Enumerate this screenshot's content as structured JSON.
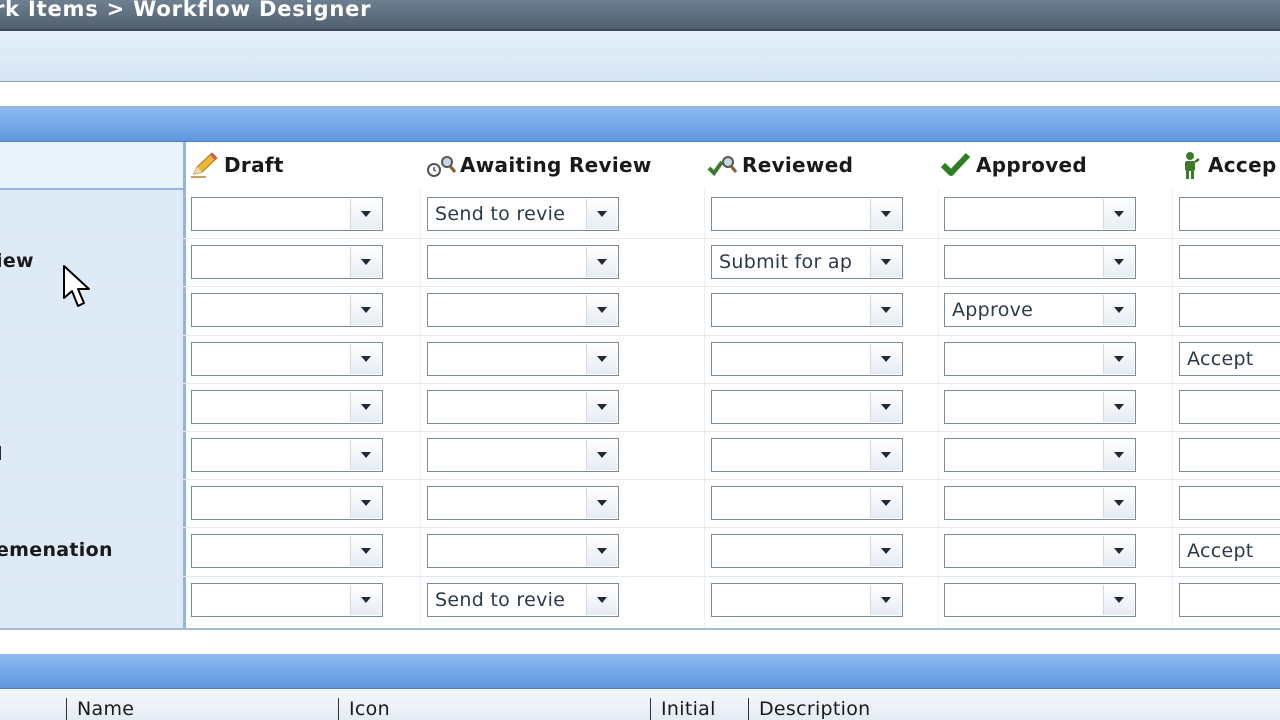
{
  "breadcrumb": {
    "text": "rk Items > Workflow Designer"
  },
  "states": [
    {
      "label": "Draft",
      "icon": "pencil-icon",
      "color": "#e0a12b"
    },
    {
      "label": "Awaiting Review",
      "icon": "magnifier-clock-icon",
      "color": "#555555"
    },
    {
      "label": "Reviewed",
      "icon": "check-magnifier-icon",
      "color": "#3a7a2a"
    },
    {
      "label": "Approved",
      "icon": "check-icon",
      "color": "#2f7d23"
    },
    {
      "label": "Accep",
      "icon": "person-icon",
      "color": "#3c7a2a"
    }
  ],
  "rows": [
    {
      "label": "",
      "cells": [
        "",
        "Send to revie",
        "",
        "",
        ""
      ]
    },
    {
      "label": "iew",
      "cells": [
        "",
        "",
        "Submit for ap",
        "",
        ""
      ]
    },
    {
      "label": "",
      "cells": [
        "",
        "",
        "",
        "Approve",
        ""
      ]
    },
    {
      "label": "",
      "cells": [
        "",
        "",
        "",
        "",
        "Accept"
      ]
    },
    {
      "label": "",
      "cells": [
        "",
        "",
        "",
        "",
        ""
      ]
    },
    {
      "label": "l",
      "cells": [
        "",
        "",
        "",
        "",
        ""
      ]
    },
    {
      "label": "",
      "cells": [
        "",
        "",
        "",
        "",
        ""
      ]
    },
    {
      "label": "emenation",
      "cells": [
        "",
        "",
        "",
        "",
        "Accept"
      ]
    },
    {
      "label": "",
      "cells": [
        "",
        "Send to revie",
        "",
        "",
        ""
      ]
    }
  ],
  "bottom_table": {
    "columns": [
      "Name",
      "Icon",
      "Initial",
      "Description"
    ]
  }
}
